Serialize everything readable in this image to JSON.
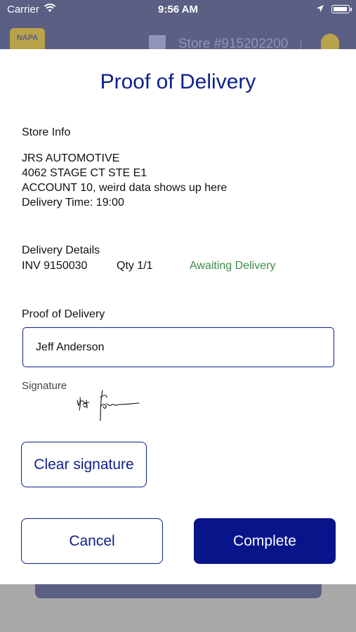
{
  "status_bar": {
    "carrier": "Carrier",
    "time": "9:56 AM"
  },
  "background": {
    "logo_text": "NAPA",
    "store_text": "Store #915202200"
  },
  "modal": {
    "title": "Proof of Delivery",
    "store_info": {
      "label": "Store Info",
      "name": "JRS AUTOMOTIVE",
      "address": "4062 STAGE CT STE E1",
      "account": "ACCOUNT 10, weird data shows up here",
      "delivery_time": "Delivery Time: 19:00"
    },
    "delivery_details": {
      "label": "Delivery Details",
      "invoice": "INV 9150030",
      "qty": "Qty 1/1",
      "status": "Awaiting Delivery"
    },
    "proof": {
      "label": "Proof of Delivery",
      "name_value": "Jeff Anderson",
      "signature_label": "Signature"
    },
    "buttons": {
      "clear_signature": "Clear signature",
      "cancel": "Cancel",
      "complete": "Complete"
    }
  },
  "colors": {
    "brand_blue": "#0d1f8c",
    "status_green": "#3b8a4a",
    "header_bg": "#5b5f84"
  },
  "icons": [
    "wifi-icon",
    "location-arrow-icon",
    "battery-icon",
    "store-icon",
    "user-icon",
    "napa-logo"
  ]
}
